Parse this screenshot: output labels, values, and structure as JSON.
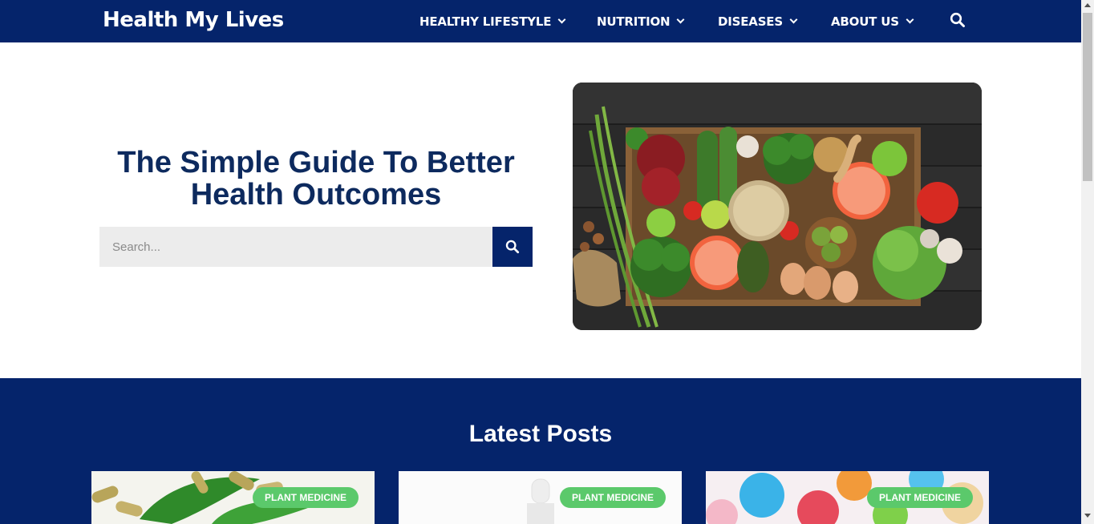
{
  "header": {
    "logo": "Health My Lives",
    "nav": [
      {
        "label": "HEALTHY LIFESTYLE"
      },
      {
        "label": "NUTRITION"
      },
      {
        "label": "DISEASES"
      },
      {
        "label": "ABOUT US"
      }
    ],
    "search_icon": "search-icon"
  },
  "hero": {
    "title_line1": "The Simple Guide To Better",
    "title_line2": "Health Outcomes",
    "search_placeholder": "Search...",
    "search_button_icon": "search-icon",
    "image": "vegetables-in-wooden-box"
  },
  "latest_posts": {
    "title": "Latest Posts",
    "cards": [
      {
        "category": "PLANT MEDICINE",
        "image": "capsules-and-cannabis-leaf"
      },
      {
        "category": "PLANT MEDICINE",
        "image": "dropper-bottle"
      },
      {
        "category": "PLANT MEDICINE",
        "image": "gummy-bears"
      }
    ]
  },
  "colors": {
    "brand_navy": "#05246b",
    "title_navy": "#0d2a5e",
    "badge_green": "#5bc96b",
    "search_bg": "#ececec"
  }
}
